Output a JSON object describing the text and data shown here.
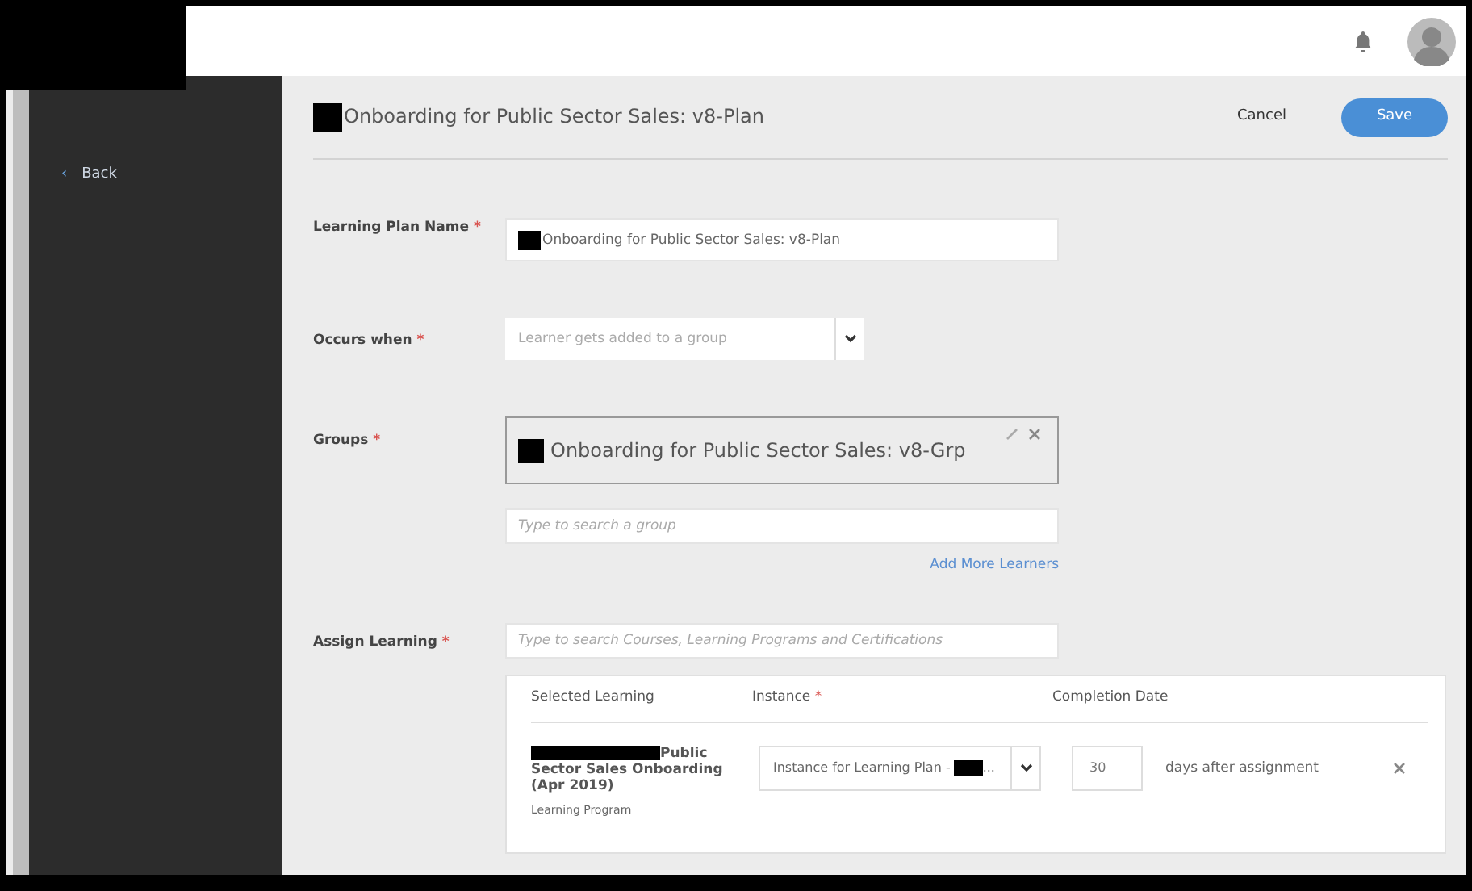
{
  "sidebar": {
    "back": {
      "icon": "‹",
      "label": "Back"
    }
  },
  "header": {
    "title": "Onboarding for Public Sector Sales: v8-Plan",
    "title_redacted": true,
    "cancel": "Cancel",
    "save": "Save"
  },
  "form": {
    "name": {
      "label": "Learning Plan Name",
      "mark": "*",
      "value": "Onboarding for Public Sector Sales: v8-Plan",
      "value_redacted": true
    },
    "occurs": {
      "label": "Occurs when",
      "mark": "*",
      "placeholder": "Learner gets added to a group"
    },
    "groups": {
      "label": "Groups",
      "mark": "*",
      "selected": "Onboarding for Public Sector Sales: v8-Grp",
      "selected_redacted": true,
      "search_placeholder": "Type to search a group",
      "add_more": "Add More Learners"
    },
    "assign": {
      "label": "Assign Learning",
      "mark": "*",
      "placeholder": "Type to search Courses, Learning Programs and Certifications"
    }
  },
  "table": {
    "columns": [
      {
        "label": "Selected Learning"
      },
      {
        "label": "Instance",
        "mark": "*"
      },
      {
        "label": "Completion Date"
      }
    ],
    "rows": [
      {
        "title": "Public Sector Sales Onboarding (Apr 2019)",
        "title_redacted": true,
        "type": "Learning Program",
        "instance": "Instance for Learning Plan -",
        "instance_redacted": true,
        "instance_tail": "...",
        "days": "30",
        "days_suffix": "days after assignment"
      }
    ]
  }
}
